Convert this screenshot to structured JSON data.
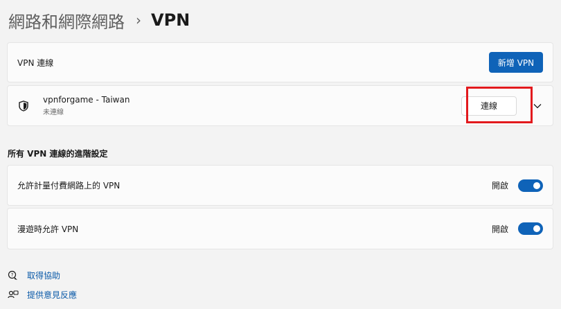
{
  "breadcrumb": {
    "parent": "網路和網際網路",
    "separator": "›",
    "current": "VPN"
  },
  "vpn_connections": {
    "label": "VPN 連線",
    "add_button": "新增 VPN"
  },
  "connection": {
    "icon": "shield-icon",
    "name": "vpnforgame - Taiwan",
    "status": "未連線",
    "connect_button": "連線",
    "expand_icon": "chevron-down-icon"
  },
  "advanced": {
    "title": "所有 VPN 連線的進階設定",
    "settings": [
      {
        "label": "允許計量付費網路上的 VPN",
        "state": "開啟",
        "on": true
      },
      {
        "label": "漫遊時允許 VPN",
        "state": "開啟",
        "on": true
      }
    ]
  },
  "links": {
    "help": "取得協助",
    "feedback": "提供意見反應"
  },
  "colors": {
    "accent": "#0f63b8",
    "highlight": "#e2191d",
    "background": "#f3f3f3"
  }
}
